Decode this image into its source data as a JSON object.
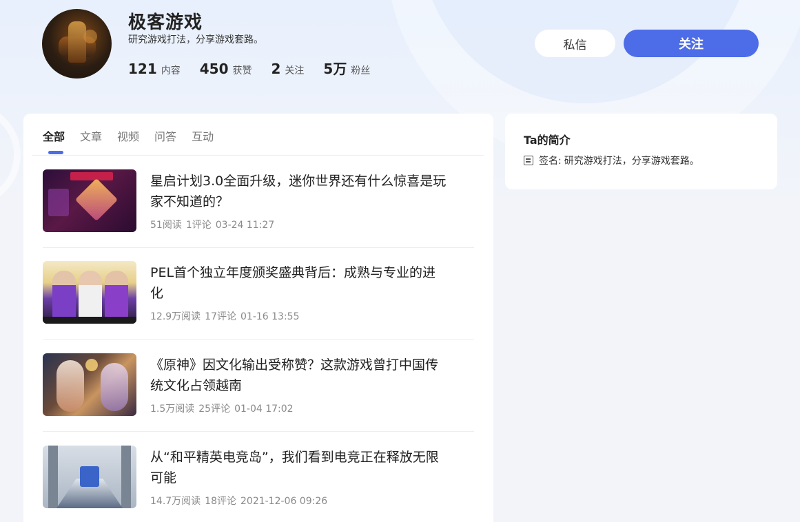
{
  "profile": {
    "name": "极客游戏",
    "bio": "研究游戏打法，分享游戏套路。",
    "stats": [
      {
        "value": "121",
        "label": "内容"
      },
      {
        "value": "450",
        "label": "获赞"
      },
      {
        "value": "2",
        "label": "关注"
      },
      {
        "value": "5万",
        "label": "粉丝"
      }
    ],
    "message_label": "私信",
    "follow_label": "关注"
  },
  "tabs": [
    {
      "label": "全部",
      "active": true
    },
    {
      "label": "文章",
      "active": false
    },
    {
      "label": "视频",
      "active": false
    },
    {
      "label": "问答",
      "active": false
    },
    {
      "label": "互动",
      "active": false
    }
  ],
  "articles": [
    {
      "title": "星启计划3.0全面升级，迷你世界还有什么惊喜是玩家不知道的？",
      "reads": "51阅读",
      "comments": "1评论",
      "date": "03-24 11:27"
    },
    {
      "title": "PEL首个独立年度颁奖盛典背后：成熟与专业的进化",
      "reads": "12.9万阅读",
      "comments": "17评论",
      "date": "01-16 13:55"
    },
    {
      "title": "《原神》因文化输出受称赞？这款游戏曾打中国传统文化占领越南",
      "reads": "1.5万阅读",
      "comments": "25评论",
      "date": "01-04 17:02"
    },
    {
      "title": "从“和平精英电竞岛”，我们看到电竞正在释放无限可能",
      "reads": "14.7万阅读",
      "comments": "18评论",
      "date": "2021-12-06 09:26"
    }
  ],
  "intro": {
    "title": "Ta的简介",
    "signature_key": "签名:",
    "signature_value": "研究游戏打法，分享游戏套路。",
    "icon": "document-icon"
  },
  "colors": {
    "accent": "#4d6ce8"
  }
}
